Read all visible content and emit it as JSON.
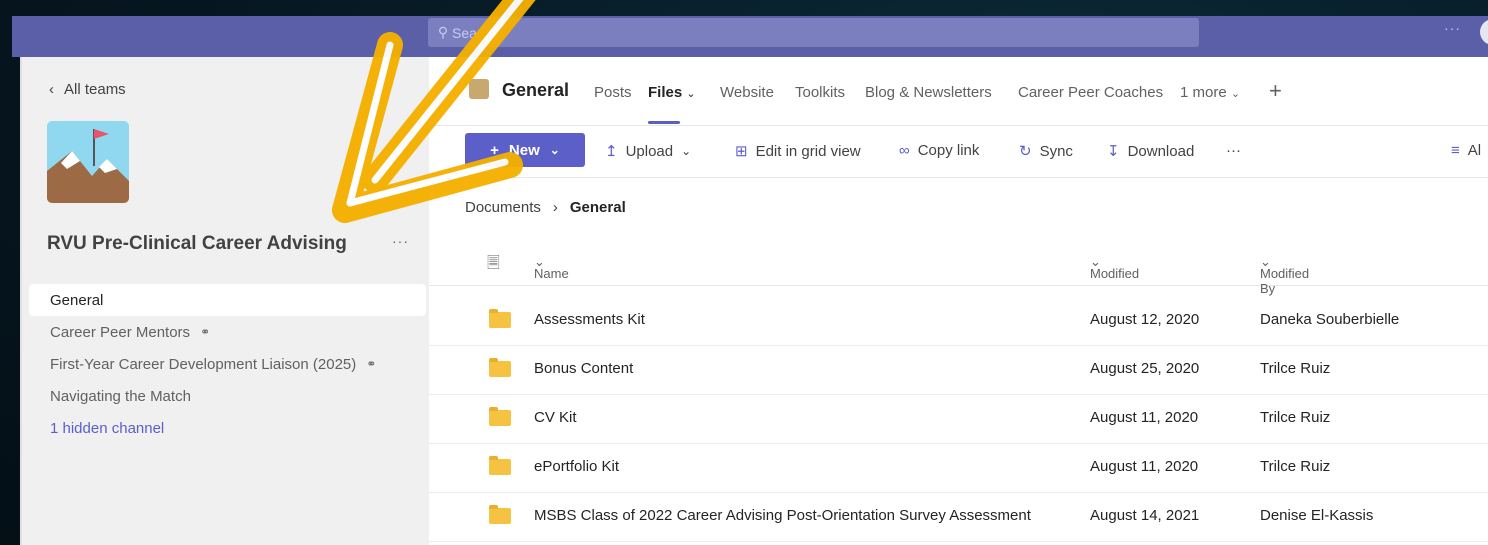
{
  "topbar": {
    "search_placeholder": "Search",
    "more": "···"
  },
  "sidebar": {
    "back_label": "All teams",
    "team_name": "RVU Pre-Clinical Career Advising",
    "team_more": "···",
    "channels": [
      {
        "label": "General",
        "selected": true,
        "private": false
      },
      {
        "label": "Career Peer Mentors",
        "selected": false,
        "private": true
      },
      {
        "label": "First-Year Career Development Liaison (2025)",
        "selected": false,
        "private": true
      },
      {
        "label": "Navigating the Match",
        "selected": false,
        "private": false
      }
    ],
    "hidden_channels": "1 hidden channel"
  },
  "header": {
    "channel": "General",
    "tabs": [
      "Posts",
      "Files",
      "Website",
      "Toolkits",
      "Blog & Newsletters",
      "Career Peer Coaches",
      "1 more"
    ],
    "active_tab": "Files"
  },
  "toolbar": {
    "new_label": "New",
    "upload_label": "Upload",
    "grid_label": "Edit in grid view",
    "copy_label": "Copy link",
    "sync_label": "Sync",
    "download_label": "Download",
    "more": "···",
    "all_label": "Al"
  },
  "breadcrumb": {
    "root": "Documents",
    "current": "General"
  },
  "table": {
    "columns": {
      "name": "Name",
      "modified": "Modified",
      "modified_by": "Modified By"
    },
    "rows": [
      {
        "name": "Assessments Kit",
        "modified": "August 12, 2020",
        "modified_by": "Daneka Souberbielle"
      },
      {
        "name": "Bonus Content",
        "modified": "August 25, 2020",
        "modified_by": "Trilce Ruiz"
      },
      {
        "name": "CV Kit",
        "modified": "August 11, 2020",
        "modified_by": "Trilce Ruiz"
      },
      {
        "name": "ePortfolio Kit",
        "modified": "August 11, 2020",
        "modified_by": "Trilce Ruiz"
      },
      {
        "name": "MSBS Class of 2022 Career Advising Post-Orientation Survey Assessment",
        "modified": "August 14, 2021",
        "modified_by": "Denise El-Kassis"
      }
    ]
  },
  "colors": {
    "accent": "#5b5fc7",
    "topbar": "#5b5fa7",
    "arrow": "#f5b800"
  }
}
